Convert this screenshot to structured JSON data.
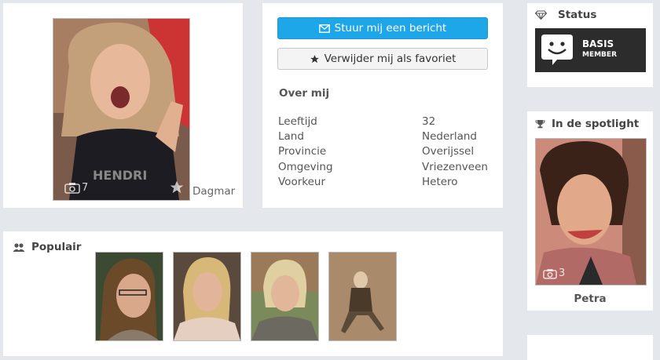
{
  "profile": {
    "name": "Dagmar",
    "photo_count": "7",
    "camera_icon": "camera-icon",
    "favorite_icon": "star-icon"
  },
  "actions": {
    "message_label": "Stuur mij een bericht",
    "message_icon": "envelope-icon",
    "favorite_label": "Verwijder mij als favoriet",
    "favorite_icon": "star-icon"
  },
  "about": {
    "heading": "Over mij",
    "rows": [
      {
        "label": "Leeftijd",
        "value": "32"
      },
      {
        "label": "Land",
        "value": "Nederland"
      },
      {
        "label": "Provincie",
        "value": "Overijssel"
      },
      {
        "label": "Omgeving",
        "value": "Vriezenveen"
      },
      {
        "label": "Voorkeur",
        "value": "Hetero"
      }
    ]
  },
  "popular": {
    "title": "Populair",
    "icon": "users-icon",
    "count": 4
  },
  "status": {
    "title": "Status",
    "icon": "diamond-icon",
    "badge_line1": "BASIS",
    "badge_line2": "MEMBER"
  },
  "spotlight": {
    "title": "In de spotlight",
    "icon": "trophy-icon",
    "name": "Petra",
    "photo_count": "3"
  },
  "colors": {
    "background": "#e4e8ec",
    "primary_button": "#1ea7e8",
    "badge_background": "#2c2c2c"
  }
}
